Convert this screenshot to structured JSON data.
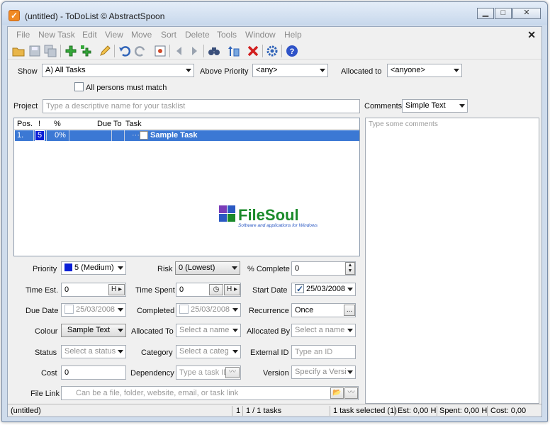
{
  "window": {
    "title": "(untitled) - ToDoList © AbstractSpoon",
    "min": "▁",
    "max": "□",
    "close": "✕"
  },
  "menu": [
    "File",
    "New Task",
    "Edit",
    "View",
    "Move",
    "Sort",
    "Delete",
    "Tools",
    "Window",
    "Help"
  ],
  "menu_close": "✕",
  "filter": {
    "show_label": "Show",
    "show_value": "A)  All Tasks",
    "priority_label": "Above Priority",
    "priority_value": "<any>",
    "allocated_label": "Allocated to",
    "allocated_value": "<anyone>",
    "match_label": "All persons must match"
  },
  "project": {
    "label": "Project",
    "placeholder": "Type a descriptive name for your tasklist"
  },
  "comments": {
    "label": "Comments",
    "format": "Simple Text",
    "placeholder": "Type some comments"
  },
  "tasklist": {
    "columns": [
      "Pos.",
      "!",
      "%",
      "Due",
      "To",
      "Task"
    ],
    "rows": [
      {
        "pos": "1.",
        "priority": "5",
        "percent": "0%",
        "task": "Sample Task"
      }
    ]
  },
  "logo": {
    "name": "FileSoul",
    "tagline": "Software and applications for Windows"
  },
  "fields": {
    "priority_label": "Priority",
    "priority": "5 (Medium)",
    "risk_label": "Risk",
    "risk": "0 (Lowest)",
    "pct_label": "% Complete",
    "pct": "0",
    "time_est_label": "Time Est.",
    "time_est": "0",
    "time_spent_label": "Time Spent",
    "time_spent": "0",
    "start_label": "Start Date",
    "start": "25/03/2008",
    "due_label": "Due Date",
    "due": "25/03/2008",
    "completed_label": "Completed",
    "completed": "25/03/2008",
    "recurrence_label": "Recurrence",
    "recurrence": "Once",
    "colour_label": "Colour",
    "colour": "Sample Text",
    "alloc_to_label": "Allocated To",
    "alloc_to": "Select a name",
    "alloc_by_label": "Allocated By",
    "alloc_by": "Select a name",
    "status_label": "Status",
    "status": "Select a status",
    "category_label": "Category",
    "category": "Select a categ",
    "extid_label": "External ID",
    "extid": "Type an ID",
    "cost_label": "Cost",
    "cost": "0",
    "dependency_label": "Dependency",
    "dependency": "Type a task ID",
    "version_label": "Version",
    "version": "Specify a Versi",
    "filelink_label": "File Link",
    "filelink": "Can be a file, folder, website, email, or task link",
    "hours_btn": "H ▸",
    "ellipsis_btn": "..."
  },
  "status": {
    "file": "(untitled)",
    "count1": "1",
    "tasks": "1 / 1 tasks",
    "selected": "1 task selected (1)",
    "est": "Est: 0,00 H",
    "spent": "Spent: 0,00 H",
    "cost": "Cost: 0,00"
  },
  "colors": {
    "selection": "#3b78d4",
    "priority_blue": "#0a1fd6",
    "logo_green": "#1a8a2a",
    "logo_blue": "#2b59c3"
  }
}
